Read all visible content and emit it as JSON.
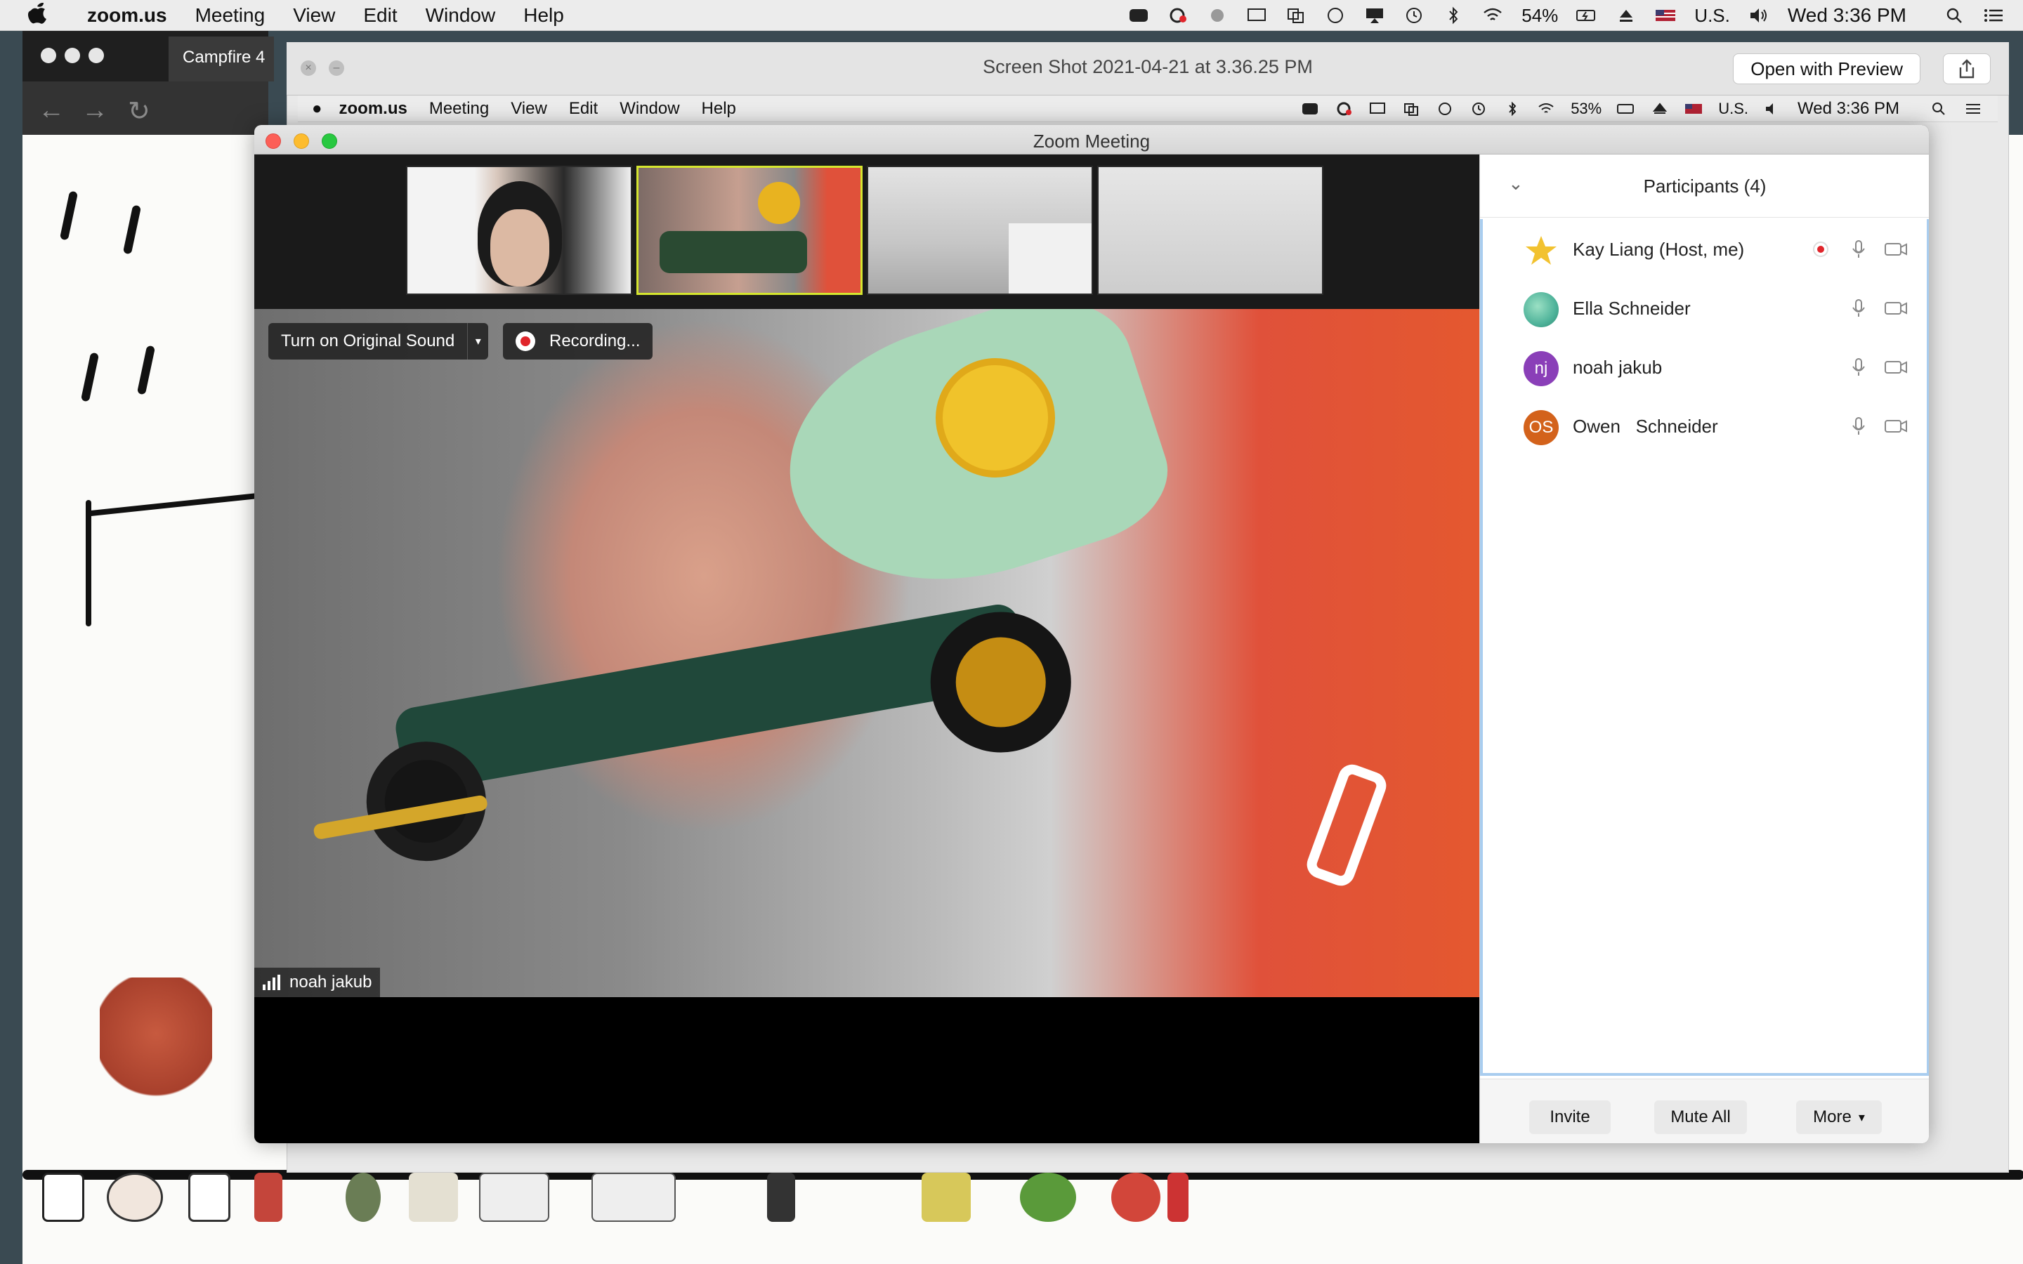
{
  "menubar": {
    "app_name": "zoom.us",
    "menus": [
      "Meeting",
      "View",
      "Edit",
      "Window",
      "Help"
    ],
    "battery": "54%",
    "input_source": "U.S.",
    "clock": "Wed 3:36 PM"
  },
  "browser": {
    "tab_title": "Campfire 4"
  },
  "preview": {
    "title": "Screen Shot 2021-04-21 at 3.36.25 PM",
    "open_button": "Open with Preview"
  },
  "inner_menubar": {
    "app_name": "zoom.us",
    "menus": [
      "Meeting",
      "View",
      "Edit",
      "Window",
      "Help"
    ],
    "battery": "53%",
    "input_source": "U.S.",
    "clock": "Wed 3:36 PM"
  },
  "zoom": {
    "window_title": "Zoom Meeting",
    "original_sound_button": "Turn on Original Sound",
    "recording_label": "Recording...",
    "active_speaker": "noah jakub",
    "panel_title": "Participants (4)",
    "participants": [
      {
        "name": "Kay Liang (Host, me)",
        "initials": "",
        "color": "#f2c230",
        "recording": true
      },
      {
        "name": "Ella Schneider",
        "initials": "",
        "color": "#4fb39a",
        "recording": false
      },
      {
        "name": "noah jakub",
        "initials": "nj",
        "color": "#8a3fb8",
        "recording": false
      },
      {
        "name": "Owen   Schneider",
        "initials": "OS",
        "color": "#d3621b",
        "recording": false
      }
    ],
    "footer": {
      "invite": "Invite",
      "mute_all": "Mute All",
      "more": "More"
    }
  },
  "colors": {
    "zoom_accent": "#a9cdef",
    "recording_red": "#e0252b",
    "active_thumb_border": "#d5e62f"
  }
}
